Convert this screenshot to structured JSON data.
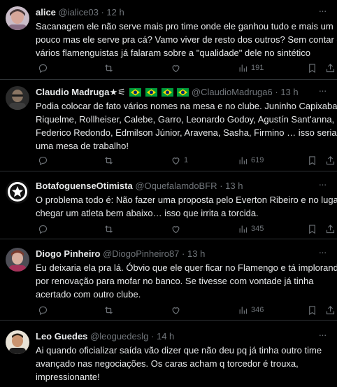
{
  "tweets": [
    {
      "name": "alice",
      "handle": "@ialice03",
      "sep": "·",
      "time": "12 h",
      "lines": [
        "Sacanagem ele não serve mais pro time onde ele ganhou tudo e mais um",
        "pouco mas ele serve pra cá? Vamo viver de resto dos outros? Sem contar q",
        "vários flamenguistas já falaram sobre a \"qualidade\" dele no sintético"
      ],
      "likes": "",
      "views": "191"
    },
    {
      "name": "Claudio Madruga★⚟",
      "handle": "@ClaudioMadruga6",
      "sep": "·",
      "time": "13 h",
      "lines": [
        "Podia colocar de fato vários nomes na mesa e no clube. Juninho Capixaba,",
        "Riquelme, Rollheiser, Calebe, Garro, Leonardo Godoy, Agustín Sant'anna,",
        "Federico Redondo, Edmilson Júnior, Aravena, Sasha, Firmino … isso seria",
        "uma mesa de trabalho!"
      ],
      "likes": "1",
      "views": "619"
    },
    {
      "name": "BotafoguenseOtimista",
      "handle": "@OquefalamdoBFR",
      "sep": "·",
      "time": "13 h",
      "lines": [
        "O problema todo é: Não fazer uma proposta pelo Everton Ribeiro e no lugar",
        "chegar um atleta bem abaixo… isso que irrita a torcida."
      ],
      "likes": "",
      "views": "345"
    },
    {
      "name": "Diogo Pinheiro",
      "handle": "@DiogoPinheiro87",
      "sep": "·",
      "time": "13 h",
      "lines": [
        "Eu deixaria ela pra lá. Óbvio que ele quer ficar no Flamengo e tá implorando",
        "por renovação para mofar no banco. Se tivesse com vontade já tinha",
        "acertado com outro clube."
      ],
      "likes": "",
      "views": "346"
    },
    {
      "name": "Leo Guedes",
      "handle": "@leoguedeslg",
      "sep": "·",
      "time": "14 h",
      "lines": [
        "Ai quando oficializar saída vão dizer que não deu pq já tinha outro time",
        "avançado nas negociações. Os caras acham q torcedor é trouxa,",
        "impressionante!"
      ],
      "likes": "",
      "views": ""
    }
  ],
  "colors": {
    "background": "#000000",
    "text": "#e7e9ea",
    "muted": "#71767b",
    "divider": "#2f3336",
    "flag_green": "#009c3b",
    "flag_yellow": "#ffdf00",
    "flag_blue": "#002776"
  },
  "icons": {
    "reply": "reply-icon",
    "retweet": "retweet-icon",
    "like": "like-icon",
    "views": "views-icon",
    "bookmark": "bookmark-icon",
    "share": "share-icon",
    "more": "more-icon"
  }
}
